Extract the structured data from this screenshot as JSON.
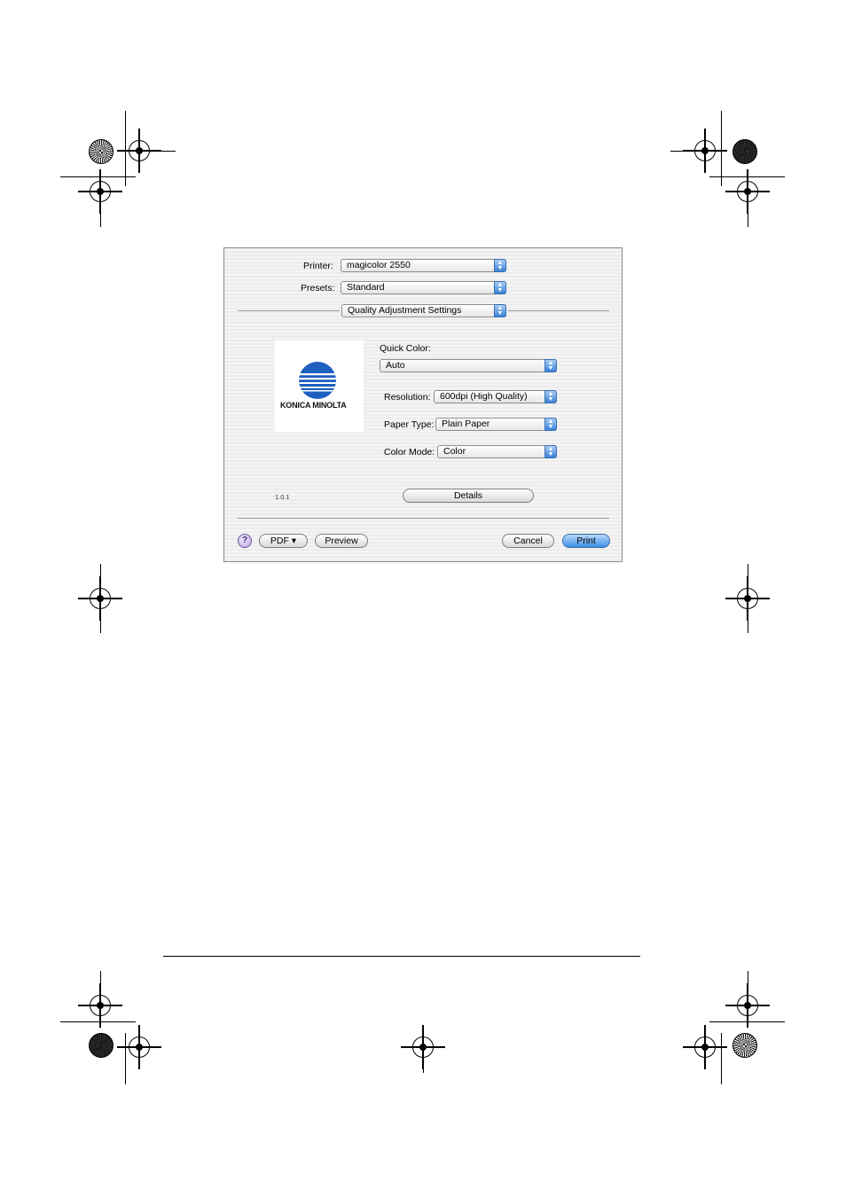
{
  "dialog": {
    "printer_label": "Printer:",
    "printer_value": "magicolor 2550",
    "presets_label": "Presets:",
    "presets_value": "Standard",
    "panel_value": "Quality Adjustment Settings",
    "quick_color_label": "Quick Color:",
    "quick_color_value": "Auto",
    "resolution_label": "Resolution:",
    "resolution_value": "600dpi (High Quality)",
    "paper_type_label": "Paper Type:",
    "paper_type_value": "Plain Paper",
    "color_mode_label": "Color Mode:",
    "color_mode_value": "Color",
    "logo_text": "KONICA MINOLTA",
    "version": "1.0.1",
    "details_button": "Details",
    "help_button": "?",
    "pdf_button": "PDF ▾",
    "preview_button": "Preview",
    "cancel_button": "Cancel",
    "print_button": "Print"
  },
  "colors": {
    "accent_blue": "#3d8fe4",
    "logo_blue": "#1f5fbf"
  }
}
